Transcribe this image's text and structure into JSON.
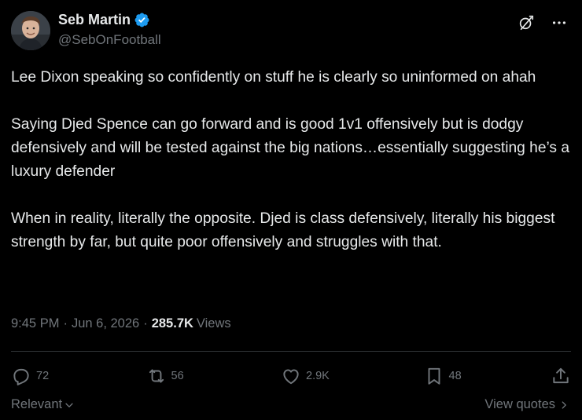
{
  "author": {
    "display_name": "Seb Martin",
    "handle": "@SebOnFootball",
    "verified": true,
    "verified_color": "#1d9bf0"
  },
  "header_icons": [
    "grok-icon",
    "more-icon"
  ],
  "tweet": {
    "text": "Lee Dixon speaking so confidently on stuff he is clearly so uninformed on ahah\n\nSaying Djed Spence can go forward and is good 1v1 offensively but is dodgy defensively and will be tested against the big nations…essentially suggesting he’s a luxury defender\n\nWhen in reality, literally the opposite. Djed is class defensively, literally his biggest strength by far, but quite poor offensively and struggles with that.",
    "time": "9:45 PM",
    "date": "Jun 6, 2026",
    "separator": "·",
    "views_count": "285.7K",
    "views_label": "Views"
  },
  "actions": {
    "replies": "72",
    "reposts": "56",
    "likes": "2.9K",
    "bookmarks": "48"
  },
  "footer": {
    "sort_label": "Relevant",
    "quotes_label": "View quotes"
  },
  "colors": {
    "background": "#000000",
    "text": "#e7e9ea",
    "muted": "#71767b",
    "divider": "#2f3336",
    "accent": "#1d9bf0"
  }
}
